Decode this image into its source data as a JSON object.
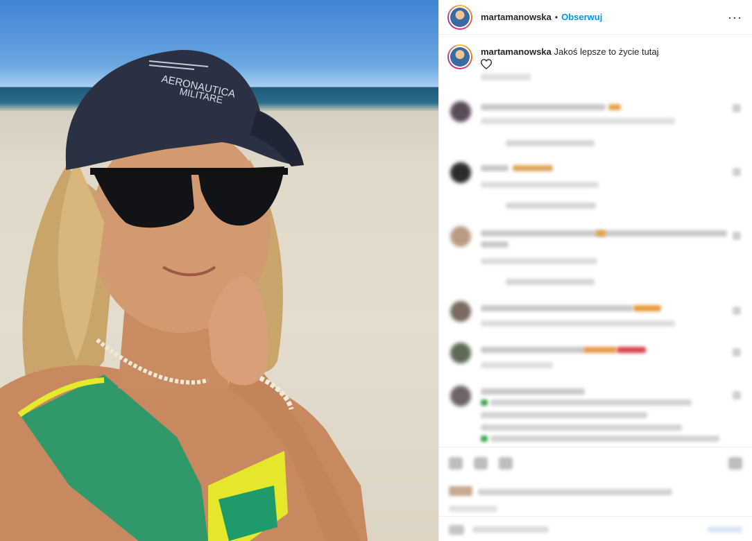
{
  "post": {
    "username": "martamanowska",
    "follow_label": "Obserwuj",
    "separator": "•",
    "more_label": "···"
  },
  "caption": {
    "username": "martamanowska",
    "text": "Jakoś lepsze to życie tutaj"
  },
  "photo": {
    "cap_text_line1": "AERONAUTICA",
    "cap_text_line2": "MILITARE"
  },
  "colors": {
    "follow": "#0095f6",
    "text": "#262626",
    "divider": "#efefef"
  }
}
